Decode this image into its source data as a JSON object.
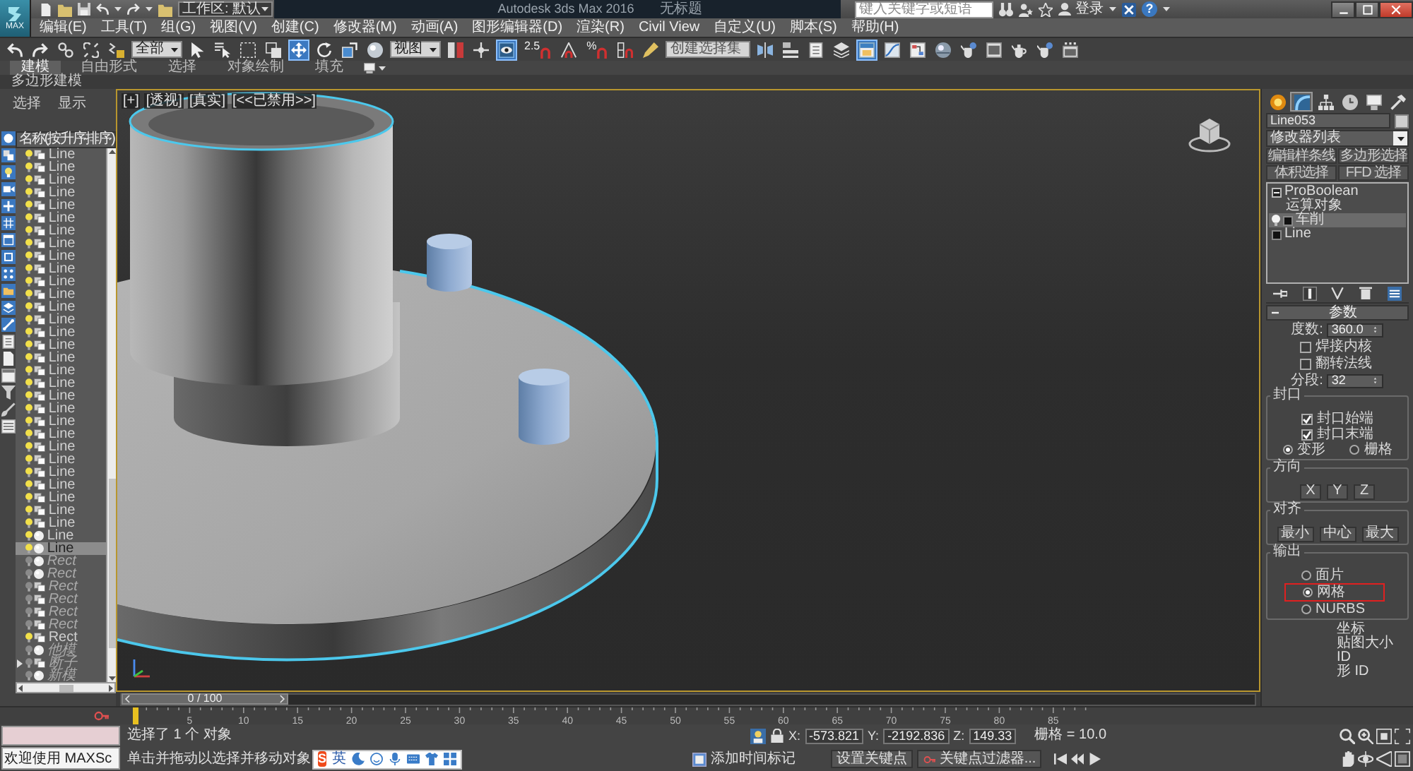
{
  "app_button": "MAX",
  "title_bar": {
    "workspace": "工作区: 默认",
    "title": "Autodesk 3ds Max 2016",
    "document": "无标题",
    "search": {
      "placeholder": "键入关键字或短语"
    },
    "sign_in": "登录",
    "help": "?"
  },
  "menu": [
    "编辑(E)",
    "工具(T)",
    "组(G)",
    "视图(V)",
    "创建(C)",
    "修改器(M)",
    "动画(A)",
    "图形编辑器(D)",
    "渲染(R)",
    "Civil View",
    "自定义(U)",
    "脚本(S)",
    "帮助(H)"
  ],
  "main_toolbar": [
    {
      "kind": "tool",
      "selected": false
    },
    {
      "kind": "tool",
      "selected": false
    },
    {
      "kind": "tool",
      "selected": false
    },
    {
      "kind": "tool",
      "selected": false
    },
    {
      "kind": "tool",
      "selected": false
    },
    {
      "kind": "dropdown",
      "value": "全部"
    },
    {
      "kind": "tool",
      "selected": false
    },
    {
      "kind": "tool",
      "selected": false
    },
    {
      "kind": "tool",
      "selected": false
    },
    {
      "kind": "tool",
      "selected": false
    },
    {
      "kind": "tool",
      "selected": true
    },
    {
      "kind": "tool",
      "selected": false
    },
    {
      "kind": "tool",
      "selected": false
    },
    {
      "kind": "tool",
      "selected": false
    },
    {
      "kind": "dropdown",
      "value": "视图"
    },
    {
      "kind": "tool",
      "selected": false
    },
    {
      "kind": "tool",
      "selected": false
    },
    {
      "kind": "tool",
      "selected": true
    },
    {
      "kind": "snap",
      "label": "2.5",
      "selected": false
    },
    {
      "kind": "tool",
      "selected": false
    },
    {
      "kind": "snap",
      "label": "%",
      "selected": false
    },
    {
      "kind": "tool",
      "selected": false
    },
    {
      "kind": "tool",
      "selected": false
    },
    {
      "kind": "field",
      "value": "创建选择集"
    },
    {
      "kind": "tool",
      "selected": false
    },
    {
      "kind": "tool",
      "selected": false
    },
    {
      "kind": "tool",
      "selected": false
    },
    {
      "kind": "tool",
      "selected": false
    },
    {
      "kind": "tool",
      "selected": true
    },
    {
      "kind": "tool",
      "selected": false
    },
    {
      "kind": "tool",
      "selected": false
    },
    {
      "kind": "tool",
      "selected": false
    },
    {
      "kind": "tool",
      "selected": false
    },
    {
      "kind": "tool",
      "selected": false
    },
    {
      "kind": "tool",
      "selected": false
    },
    {
      "kind": "tool",
      "selected": false
    },
    {
      "kind": "tool",
      "selected": false
    }
  ],
  "ribbon": {
    "tabs": [
      {
        "label": "建模",
        "selected": true
      },
      {
        "label": "自由形式",
        "selected": false
      },
      {
        "label": "选择",
        "selected": false
      },
      {
        "label": "对象绘制",
        "selected": false
      },
      {
        "label": "填充",
        "selected": false
      }
    ],
    "panel": "多边形建模"
  },
  "scene_explorer": {
    "tabs": [
      {
        "label": "选择",
        "selected": false
      },
      {
        "label": "显示",
        "selected": false
      }
    ],
    "column": "名称(按升序排序)",
    "rows": [
      {
        "name": "Line",
        "kind": "shape",
        "visible": true,
        "selected": false,
        "expandable": false
      },
      {
        "name": "Line",
        "kind": "shape",
        "visible": true,
        "selected": false,
        "expandable": false
      },
      {
        "name": "Line",
        "kind": "shape",
        "visible": true,
        "selected": false,
        "expandable": false
      },
      {
        "name": "Line",
        "kind": "shape",
        "visible": true,
        "selected": false,
        "expandable": false
      },
      {
        "name": "Line",
        "kind": "shape",
        "visible": true,
        "selected": false,
        "expandable": false
      },
      {
        "name": "Line",
        "kind": "shape",
        "visible": true,
        "selected": false,
        "expandable": false
      },
      {
        "name": "Line",
        "kind": "shape",
        "visible": true,
        "selected": false,
        "expandable": false
      },
      {
        "name": "Line",
        "kind": "shape",
        "visible": true,
        "selected": false,
        "expandable": false
      },
      {
        "name": "Line",
        "kind": "shape",
        "visible": true,
        "selected": false,
        "expandable": false
      },
      {
        "name": "Line",
        "kind": "shape",
        "visible": true,
        "selected": false,
        "expandable": false
      },
      {
        "name": "Line",
        "kind": "shape",
        "visible": true,
        "selected": false,
        "expandable": false
      },
      {
        "name": "Line",
        "kind": "shape",
        "visible": true,
        "selected": false,
        "expandable": false
      },
      {
        "name": "Line",
        "kind": "shape",
        "visible": true,
        "selected": false,
        "expandable": false
      },
      {
        "name": "Line",
        "kind": "shape",
        "visible": true,
        "selected": false,
        "expandable": false
      },
      {
        "name": "Line",
        "kind": "shape",
        "visible": true,
        "selected": false,
        "expandable": false
      },
      {
        "name": "Line",
        "kind": "shape",
        "visible": true,
        "selected": false,
        "expandable": false
      },
      {
        "name": "Line",
        "kind": "shape",
        "visible": true,
        "selected": false,
        "expandable": false
      },
      {
        "name": "Line",
        "kind": "shape",
        "visible": true,
        "selected": false,
        "expandable": false
      },
      {
        "name": "Line",
        "kind": "shape",
        "visible": true,
        "selected": false,
        "expandable": false
      },
      {
        "name": "Line",
        "kind": "shape",
        "visible": true,
        "selected": false,
        "expandable": false
      },
      {
        "name": "Line",
        "kind": "shape",
        "visible": true,
        "selected": false,
        "expandable": false
      },
      {
        "name": "Line",
        "kind": "shape",
        "visible": true,
        "selected": false,
        "expandable": false
      },
      {
        "name": "Line",
        "kind": "shape",
        "visible": true,
        "selected": false,
        "expandable": false
      },
      {
        "name": "Line",
        "kind": "shape",
        "visible": true,
        "selected": false,
        "expandable": false
      },
      {
        "name": "Line",
        "kind": "shape",
        "visible": true,
        "selected": false,
        "expandable": false
      },
      {
        "name": "Line",
        "kind": "shape",
        "visible": true,
        "selected": false,
        "expandable": false
      },
      {
        "name": "Line",
        "kind": "shape",
        "visible": true,
        "selected": false,
        "expandable": false
      },
      {
        "name": "Line",
        "kind": "shape",
        "visible": true,
        "selected": false,
        "expandable": false
      },
      {
        "name": "Line",
        "kind": "shape",
        "visible": true,
        "selected": false,
        "expandable": false
      },
      {
        "name": "Line",
        "kind": "shape",
        "visible": true,
        "selected": false,
        "expandable": false
      },
      {
        "name": "Line",
        "kind": "geometry",
        "visible": true,
        "selected": false,
        "expandable": false
      },
      {
        "name": "Line",
        "kind": "geometry",
        "visible": true,
        "selected": true,
        "expandable": false
      },
      {
        "name": "Rect",
        "kind": "geometry",
        "visible": false,
        "selected": false,
        "expandable": false
      },
      {
        "name": "Rect",
        "kind": "geometry",
        "visible": false,
        "selected": false,
        "expandable": false
      },
      {
        "name": "Rect",
        "kind": "shape",
        "visible": false,
        "selected": false,
        "expandable": false
      },
      {
        "name": "Rect",
        "kind": "shape",
        "visible": false,
        "selected": false,
        "expandable": false
      },
      {
        "name": "Rect",
        "kind": "shape",
        "visible": false,
        "selected": false,
        "expandable": false
      },
      {
        "name": "Rect",
        "kind": "shape",
        "visible": false,
        "selected": false,
        "expandable": false
      },
      {
        "name": "Rect",
        "kind": "shape",
        "visible": true,
        "selected": false,
        "expandable": false
      },
      {
        "name": "他模",
        "kind": "geometry",
        "visible": false,
        "selected": false,
        "expandable": false
      },
      {
        "name": "断子",
        "kind": "shape",
        "visible": false,
        "selected": false,
        "expandable": true
      },
      {
        "name": "新模",
        "kind": "geometry",
        "visible": false,
        "selected": false,
        "expandable": false
      }
    ]
  },
  "viewport": {
    "labels": [
      "[+]",
      "[透视]",
      "[真实]",
      "[<<已禁用>>]"
    ]
  },
  "command_panel": {
    "tabs": [
      {
        "selected": false
      },
      {
        "selected": true
      },
      {
        "selected": false
      },
      {
        "selected": false
      },
      {
        "selected": false
      },
      {
        "selected": false
      }
    ],
    "object_name": "Line053",
    "modifier_list": "修改器列表",
    "modifier_buttons": [
      "编辑样条线",
      "多边形选择",
      "体积选择",
      "FFD 选择"
    ],
    "stack": [
      {
        "label": "ProBoolean",
        "kind": "object",
        "selected": false,
        "expanded": true,
        "children": [
          {
            "label": "运算对象",
            "selected": false
          }
        ]
      },
      {
        "label": "车削",
        "kind": "modifier",
        "selected": true
      },
      {
        "label": "Line",
        "kind": "object",
        "selected": false
      }
    ],
    "rollout": {
      "title": "参数",
      "expanded": true,
      "degrees": {
        "label": "度数:",
        "value": "360.0"
      },
      "checks": [
        {
          "label": "焊接内核",
          "checked": false
        },
        {
          "label": "翻转法线",
          "checked": false
        }
      ],
      "segments": {
        "label": "分段:",
        "value": "32"
      },
      "groups": [
        {
          "title": "封口",
          "items": [
            {
              "kind": "check",
              "label": "封口始端",
              "checked": true
            },
            {
              "kind": "check",
              "label": "封口末端",
              "checked": true
            },
            {
              "kind": "radios",
              "options": [
                {
                  "label": "变形",
                  "selected": true
                },
                {
                  "label": "栅格",
                  "selected": false
                }
              ]
            }
          ]
        },
        {
          "title": "方向",
          "items": [
            {
              "kind": "buttons",
              "labels": [
                "X",
                "Y",
                "Z"
              ]
            }
          ]
        },
        {
          "title": "对齐",
          "items": [
            {
              "kind": "buttons",
              "labels": [
                "最小",
                "中心",
                "最大"
              ]
            }
          ]
        },
        {
          "title": "输出",
          "items": [
            {
              "kind": "radio",
              "label": "面片",
              "selected": false,
              "highlighted": false
            },
            {
              "kind": "radio",
              "label": "网格",
              "selected": true,
              "highlighted": true
            },
            {
              "kind": "radio",
              "label": "NURBS",
              "selected": false,
              "highlighted": false
            }
          ]
        }
      ],
      "partial_lines": [
        "坐标",
        "贴图大小",
        "ID",
        "形 ID"
      ]
    }
  },
  "time_slider": {
    "label": "0 / 100",
    "level": 0
  },
  "track_bar": {
    "ticks": [
      "5",
      "10",
      "15",
      "20",
      "25",
      "30",
      "35",
      "40",
      "45",
      "50",
      "55",
      "60",
      "65",
      "70",
      "75",
      "80",
      "85"
    ]
  },
  "status_bar": {
    "listener": "欢迎使用 MAXSc",
    "selection": "选择了 1 个 对象",
    "prompt": "单击并拖动以选择并移动对象",
    "coords": [
      {
        "axis": "X:",
        "value": "-573.821"
      },
      {
        "axis": "Y:",
        "value": "-2192.836"
      },
      {
        "axis": "Z:",
        "value": "149.33"
      }
    ],
    "grid": "栅格 = 10.0",
    "time_tag": "添加时间标记",
    "set_key": "设置关键点",
    "key_filters": "关键点过滤器..."
  },
  "ime": {
    "logo": "S",
    "mode": "英"
  }
}
